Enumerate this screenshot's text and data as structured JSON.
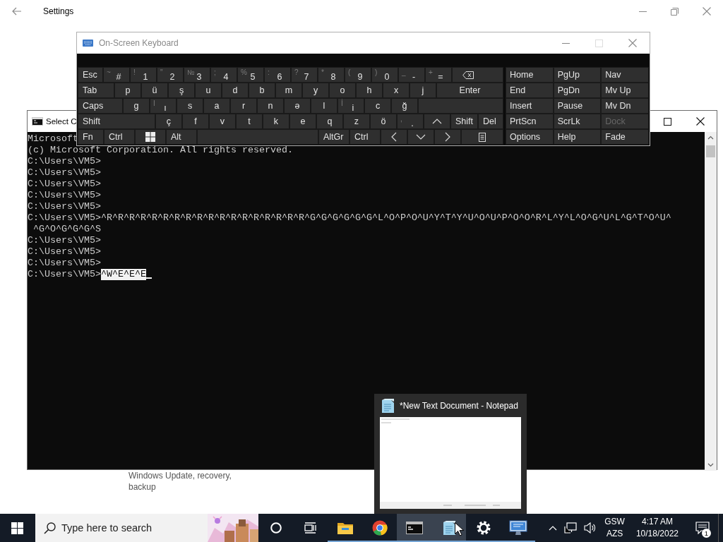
{
  "settings_window": {
    "title": "Settings",
    "item_description": "Windows Update, recovery, backup"
  },
  "console_window": {
    "title": "Select C",
    "lines": [
      {
        "text": "Microsoft",
        "kind": "line",
        "cursor": false
      },
      {
        "text": "(c) Microsoft Corporation. All rights reserved.",
        "kind": "line",
        "cursor": false
      },
      {
        "text": "C:\\Users\\VM5>",
        "kind": "line",
        "cursor": false
      },
      {
        "text": "C:\\Users\\VM5>",
        "kind": "line",
        "cursor": false
      },
      {
        "text": "C:\\Users\\VM5>",
        "kind": "line",
        "cursor": false
      },
      {
        "text": "C:\\Users\\VM5>",
        "kind": "line",
        "cursor": false
      },
      {
        "text": "C:\\Users\\VM5>",
        "kind": "line",
        "cursor": false
      },
      {
        "text": "C:\\Users\\VM5>^R^R^R^R^R^R^R^R^R^R^R^R^R^R^R^R^R^R^G^G^G^G^G^G^L^O^P^O^U^Y^T^Y^U^O^U^P^O^O^R^L^Y^L^O^G^U^L^G^T^O^U^",
        "kind": "line",
        "cursor": false
      },
      {
        "text": "^G^O^G^G^G^S",
        "kind": "continuation",
        "cursor": false
      },
      {
        "text": "C:\\Users\\VM5>",
        "kind": "line",
        "cursor": false
      },
      {
        "text": "C:\\Users\\VM5>",
        "kind": "line",
        "cursor": false
      },
      {
        "text": "C:\\Users\\VM5>",
        "kind": "line",
        "cursor": false
      },
      {
        "text": "C:\\Users\\VM5>",
        "kind": "line",
        "selection": "^W^E^E^E",
        "cursor": true
      }
    ]
  },
  "keyboard_window": {
    "title": "On-Screen Keyboard",
    "rows": [
      [
        {
          "kind": "mod",
          "label": "Esc"
        },
        {
          "kind": "char",
          "label": "#",
          "shift": "~"
        },
        {
          "kind": "char",
          "label": "1",
          "shift": "!"
        },
        {
          "kind": "char",
          "label": "2",
          "shift": "\""
        },
        {
          "kind": "char",
          "label": "3",
          "shift": "№"
        },
        {
          "kind": "char",
          "label": "4",
          "shift": ";"
        },
        {
          "kind": "char",
          "label": "5",
          "shift": "%"
        },
        {
          "kind": "char",
          "label": "6",
          "shift": ":"
        },
        {
          "kind": "char",
          "label": "7",
          "shift": "?"
        },
        {
          "kind": "char",
          "label": "8",
          "shift": "*"
        },
        {
          "kind": "char",
          "label": "9",
          "shift": "("
        },
        {
          "kind": "char",
          "label": "0",
          "shift": ")"
        },
        {
          "kind": "char",
          "label": "-",
          "shift": "_"
        },
        {
          "kind": "char",
          "label": "=",
          "shift": "+"
        },
        {
          "kind": "backspace"
        }
      ],
      [
        {
          "kind": "mod",
          "label": "Tab"
        },
        {
          "kind": "char",
          "label": "p"
        },
        {
          "kind": "char",
          "label": "ü"
        },
        {
          "kind": "char",
          "label": "ş"
        },
        {
          "kind": "char",
          "label": "u"
        },
        {
          "kind": "char",
          "label": "d"
        },
        {
          "kind": "char",
          "label": "b"
        },
        {
          "kind": "char",
          "label": "m"
        },
        {
          "kind": "char",
          "label": "y"
        },
        {
          "kind": "char",
          "label": "o"
        },
        {
          "kind": "char",
          "label": "h"
        },
        {
          "kind": "char",
          "label": "x"
        },
        {
          "kind": "char",
          "label": "j"
        },
        {
          "kind": "fill",
          "label": "Enter"
        }
      ],
      [
        {
          "kind": "mod",
          "label": "Caps"
        },
        {
          "kind": "char",
          "label": "g"
        },
        {
          "kind": "char",
          "label": "ı",
          "shift": "I"
        },
        {
          "kind": "char",
          "label": "s"
        },
        {
          "kind": "char",
          "label": "a"
        },
        {
          "kind": "char",
          "label": "r"
        },
        {
          "kind": "char",
          "label": "n"
        },
        {
          "kind": "char",
          "label": "ə"
        },
        {
          "kind": "char",
          "label": "l"
        },
        {
          "kind": "char",
          "label": "i",
          "shift": "İ"
        },
        {
          "kind": "char",
          "label": "c"
        },
        {
          "kind": "char",
          "label": "ğ"
        },
        {
          "kind": "blank"
        }
      ],
      [
        {
          "kind": "fill",
          "label": "Shift"
        },
        {
          "kind": "char",
          "label": "ç"
        },
        {
          "kind": "char",
          "label": "f"
        },
        {
          "kind": "char",
          "label": "v"
        },
        {
          "kind": "char",
          "label": "t"
        },
        {
          "kind": "char",
          "label": "k"
        },
        {
          "kind": "char",
          "label": "e"
        },
        {
          "kind": "char",
          "label": "q"
        },
        {
          "kind": "char",
          "label": "z"
        },
        {
          "kind": "char",
          "label": "ö"
        },
        {
          "kind": "char",
          "label": ".",
          "shift": ","
        },
        {
          "kind": "up"
        },
        {
          "kind": "mod",
          "label": "Shift"
        },
        {
          "kind": "mod",
          "label": "Del"
        }
      ],
      [
        {
          "kind": "mod",
          "label": "Fn"
        },
        {
          "kind": "mod",
          "label": "Ctrl"
        },
        {
          "kind": "windows"
        },
        {
          "kind": "mod",
          "label": "Alt"
        },
        {
          "kind": "space"
        },
        {
          "kind": "mod",
          "label": "AltGr"
        },
        {
          "kind": "mod",
          "label": "Ctrl"
        },
        {
          "kind": "left"
        },
        {
          "kind": "down"
        },
        {
          "kind": "right"
        },
        {
          "kind": "menu"
        }
      ]
    ],
    "side_keys": [
      [
        {
          "label": "Home",
          "disabled": false
        },
        {
          "label": "PgUp",
          "disabled": false
        },
        {
          "label": "Nav",
          "disabled": false
        }
      ],
      [
        {
          "label": "End",
          "disabled": false
        },
        {
          "label": "PgDn",
          "disabled": false
        },
        {
          "label": "Mv Up",
          "disabled": false
        }
      ],
      [
        {
          "label": "Insert",
          "disabled": false
        },
        {
          "label": "Pause",
          "disabled": false
        },
        {
          "label": "Mv Dn",
          "disabled": false
        }
      ],
      [
        {
          "label": "PrtScn",
          "disabled": false
        },
        {
          "label": "ScrLk",
          "disabled": false
        },
        {
          "label": "Dock",
          "disabled": true
        }
      ],
      [
        {
          "label": "Options",
          "disabled": false
        },
        {
          "label": "Help",
          "disabled": false
        },
        {
          "label": "Fade",
          "disabled": false
        }
      ]
    ]
  },
  "preview_popup": {
    "title": "*New Text Document - Notepad"
  },
  "taskbar": {
    "search": {
      "placeholder": "Type here to search"
    },
    "apps": [
      {
        "kind": "cortana",
        "open": false,
        "highlighted": false
      },
      {
        "kind": "task_view",
        "open": false,
        "highlighted": false
      },
      {
        "kind": "folder",
        "open": true,
        "highlighted": false
      },
      {
        "kind": "browser",
        "open": true,
        "highlighted": false
      },
      {
        "kind": "terminal",
        "open": true,
        "highlighted": true
      },
      {
        "kind": "notepad",
        "open": true,
        "highlighted": true
      },
      {
        "kind": "settings",
        "open": true,
        "highlighted": false
      },
      {
        "kind": "monitor",
        "open": true,
        "highlighted": false
      }
    ],
    "language": [
      "GSW",
      "AZS"
    ],
    "time": "4:17 AM",
    "date": "10/18/2022",
    "notification_count": "1"
  }
}
